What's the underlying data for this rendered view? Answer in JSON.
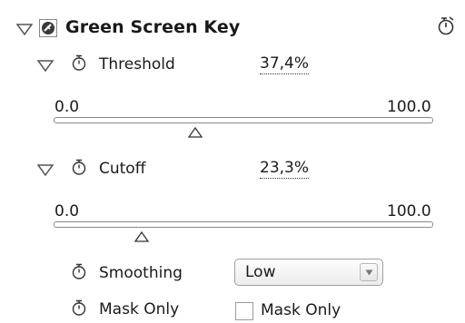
{
  "effect": {
    "title": "Green Screen Key",
    "title_icon": "fx-icon",
    "reset_icon": "reset-icon"
  },
  "threshold": {
    "label": "Threshold",
    "value": "37,4%",
    "range_min": "0.0",
    "range_max": "100.0",
    "slider_fraction": 0.374
  },
  "cutoff": {
    "label": "Cutoff",
    "value": "23,3%",
    "range_min": "0.0",
    "range_max": "100.0",
    "slider_fraction": 0.233
  },
  "smoothing": {
    "label": "Smoothing",
    "selected": "Low"
  },
  "mask_only": {
    "label": "Mask Only",
    "checkbox_label": "Mask Only",
    "checked": false
  }
}
